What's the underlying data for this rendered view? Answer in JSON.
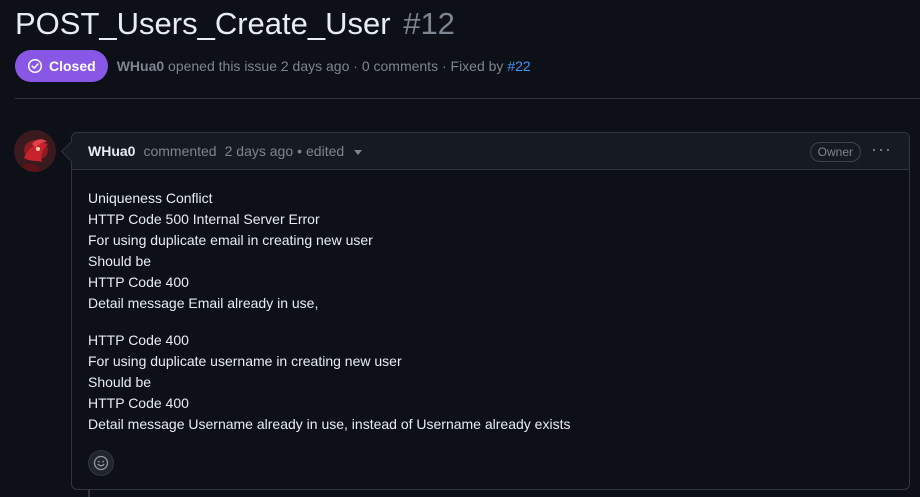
{
  "issue": {
    "title": "POST_Users_Create_User",
    "number": "#12",
    "state": "Closed",
    "author": "WHua0",
    "opened_text": "opened this issue 2 days ago · 0 comments · Fixed by",
    "fixed_by": "#22"
  },
  "comment": {
    "author": "WHua0",
    "action": "commented",
    "time": "2 days ago",
    "edited": "edited",
    "badge": "Owner",
    "more": "···",
    "paragraphs": [
      [
        "Uniqueness Conflict",
        "HTTP Code 500 Internal Server Error",
        "For using duplicate email in creating new user",
        "Should be",
        "HTTP Code 400",
        "Detail message Email already in use,"
      ],
      [
        "HTTP Code 400",
        "For using duplicate username in creating new user",
        "Should be",
        "HTTP Code 400",
        "Detail message Username already in use, instead of Username already exists"
      ]
    ]
  },
  "colors": {
    "closed_badge": "#8957e5",
    "link": "#4493f8",
    "background": "#0d1117",
    "muted": "#7d8590"
  },
  "icons": {
    "state": "check-circle-icon",
    "reaction": "smiley-icon",
    "edited_dropdown": "triangle-down-icon",
    "more": "kebab-horizontal-icon"
  }
}
